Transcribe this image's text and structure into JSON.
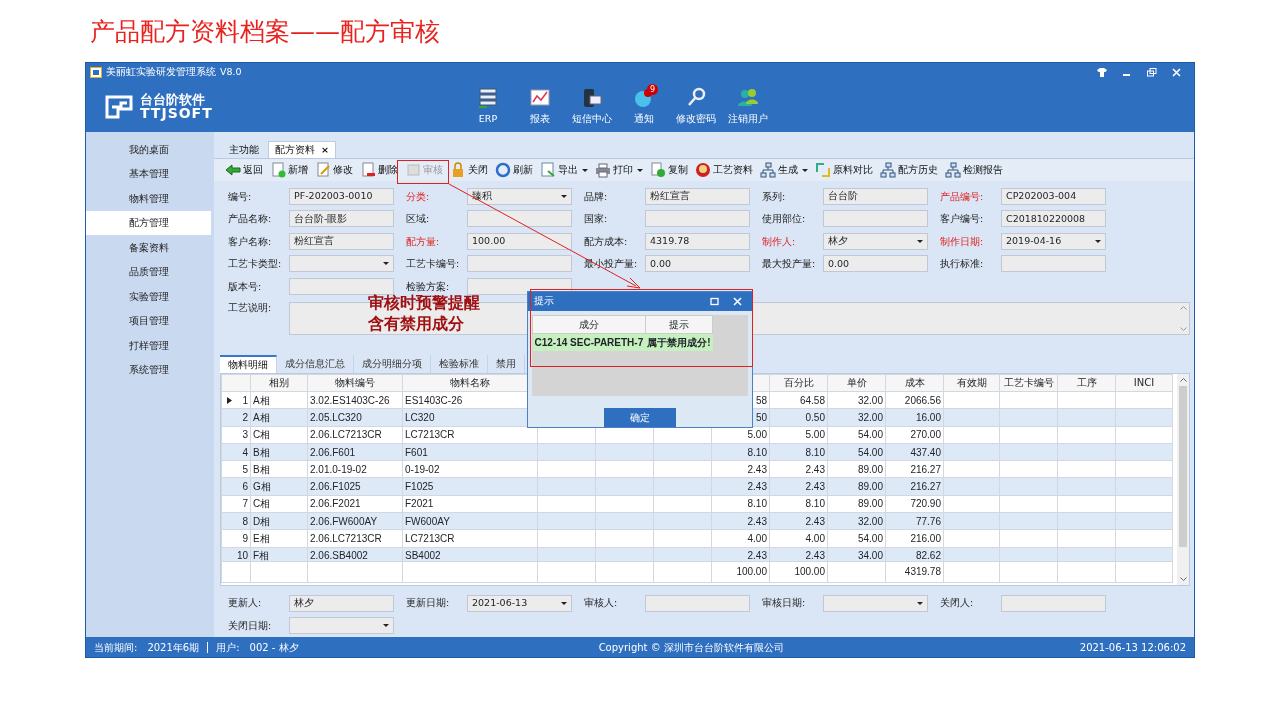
{
  "slide_title": "产品配方资料档案——配方审核",
  "window": {
    "title": "美丽虹实验研发管理系统",
    "version": "V8.0"
  },
  "logo": {
    "name": "台台阶软件",
    "latin": "TTJSOFT"
  },
  "header_buttons": [
    {
      "label": "ERP"
    },
    {
      "label": "报表"
    },
    {
      "label": "短信中心"
    },
    {
      "label": "通知",
      "badge": "9"
    },
    {
      "label": "修改密码"
    },
    {
      "label": "注销用户"
    }
  ],
  "sidebar": {
    "items": [
      {
        "label": "我的桌面",
        "selected": false
      },
      {
        "label": "基本管理",
        "selected": false
      },
      {
        "label": "物料管理",
        "selected": false
      },
      {
        "label": "配方管理",
        "selected": true
      },
      {
        "label": "备案资料",
        "selected": false
      },
      {
        "label": "品质管理",
        "selected": false
      },
      {
        "label": "实验管理",
        "selected": false
      },
      {
        "label": "项目管理",
        "selected": false
      },
      {
        "label": "打样管理",
        "selected": false
      },
      {
        "label": "系统管理",
        "selected": false
      }
    ]
  },
  "tabs": [
    {
      "label": "主功能",
      "selected": false
    },
    {
      "label": "配方资料",
      "selected": true,
      "close": "×"
    }
  ],
  "toolbar": [
    {
      "label": "返回",
      "disabled": false,
      "menu": false
    },
    {
      "label": "新增",
      "disabled": false,
      "menu": false
    },
    {
      "label": "修改",
      "disabled": false,
      "menu": false
    },
    {
      "label": "删除",
      "disabled": false,
      "menu": false
    },
    {
      "label": "审核",
      "disabled": true,
      "menu": false
    },
    {
      "label": "关闭",
      "disabled": false,
      "menu": false
    },
    {
      "label": "刷新",
      "disabled": false,
      "menu": false
    },
    {
      "label": "导出",
      "disabled": false,
      "menu": true
    },
    {
      "label": "打印",
      "disabled": false,
      "menu": true
    },
    {
      "label": "复制",
      "disabled": false,
      "menu": false
    },
    {
      "label": "工艺资料",
      "disabled": false,
      "menu": false
    },
    {
      "label": "生成",
      "disabled": false,
      "menu": true
    },
    {
      "label": "原料对比",
      "disabled": false,
      "menu": false
    },
    {
      "label": "配方历史",
      "disabled": false,
      "menu": false
    },
    {
      "label": "检测报告",
      "disabled": false,
      "menu": false
    }
  ],
  "form": {
    "rows": [
      [
        {
          "label": "编号:",
          "value": "PF-202003-0010",
          "required": false,
          "kind": "text"
        },
        {
          "label": "分类:",
          "value": "臻积",
          "required": true,
          "kind": "select"
        },
        {
          "label": "品牌:",
          "value": "粉红宣言",
          "required": false,
          "kind": "text"
        },
        {
          "label": "系列:",
          "value": "台台阶",
          "required": false,
          "kind": "text"
        },
        {
          "label": "产品编号:",
          "value": "CP202003-004",
          "required": true,
          "kind": "text"
        }
      ],
      [
        {
          "label": "产品名称:",
          "value": "台台阶-眼影",
          "required": false,
          "kind": "text"
        },
        {
          "label": "区域:",
          "required": false,
          "kind": "text"
        },
        {
          "label": "国家:",
          "required": false,
          "kind": "text"
        },
        {
          "label": "使用部位:",
          "required": false,
          "kind": "text"
        },
        {
          "label": "客户编号:",
          "value": "C201810220008",
          "required": false,
          "kind": "text"
        }
      ],
      [
        {
          "label": "客户名称:",
          "value": "粉红宣言",
          "required": false,
          "kind": "text"
        },
        {
          "label": "配方量:",
          "value": "100.00",
          "required": true,
          "kind": "text"
        },
        {
          "label": "配方成本:",
          "value": "4319.78",
          "required": false,
          "kind": "text"
        },
        {
          "label": "制作人:",
          "value": "林夕",
          "required": true,
          "kind": "select"
        },
        {
          "label": "制作日期:",
          "value": "2019-04-16",
          "required": true,
          "kind": "select"
        }
      ],
      [
        {
          "label": "工艺卡类型:",
          "required": false,
          "kind": "select"
        },
        {
          "label": "工艺卡编号:",
          "required": false,
          "kind": "text"
        },
        {
          "label": "最小投产量:",
          "value": "0.00",
          "required": false,
          "kind": "text"
        },
        {
          "label": "最大投产量:",
          "value": "0.00",
          "required": false,
          "kind": "text"
        },
        {
          "label": "执行标准:",
          "required": false,
          "kind": "text"
        }
      ],
      [
        {
          "label": "版本号:",
          "required": false,
          "kind": "text"
        },
        {
          "label": "检验方案:",
          "required": false,
          "kind": "text"
        }
      ]
    ],
    "notes": {
      "label": "工艺说明:"
    }
  },
  "grid_tabs": [
    {
      "label": "物料明细",
      "selected": true
    },
    {
      "label": "成分信息汇总",
      "selected": false
    },
    {
      "label": "成分明细分项",
      "selected": false
    },
    {
      "label": "检验标准",
      "selected": false
    },
    {
      "label": "禁用",
      "selected": false
    }
  ],
  "table": {
    "columns": [
      "相别",
      "物料编号",
      "物料名称",
      "百分比",
      "单价",
      "成本",
      "有效期",
      "工艺卡编号",
      "工序",
      "INCI"
    ],
    "rows": [
      {
        "selected": true,
        "no": "1",
        "group": "A相",
        "code": "3.02.ES1403C-26",
        "name": "ES1403C-26",
        "column_8": "58",
        "percent": "64.58",
        "price": "32.00",
        "cost": "2066.56"
      },
      {
        "selected": false,
        "no": "2",
        "group": "A相",
        "code": "2.05.LC320",
        "name": "LC320",
        "column_8": "50",
        "percent": "0.50",
        "price": "32.00",
        "cost": "16.00"
      },
      {
        "selected": false,
        "no": "3",
        "group": "C相",
        "code": "2.06.LC7213CR",
        "name": "LC7213CR",
        "column_8": "5.00",
        "percent": "5.00",
        "price": "54.00",
        "cost": "270.00"
      },
      {
        "selected": false,
        "no": "4",
        "group": "B相",
        "code": "2.06.F601",
        "name": "F601",
        "column_8": "8.10",
        "percent": "8.10",
        "price": "54.00",
        "cost": "437.40"
      },
      {
        "selected": false,
        "no": "5",
        "group": "B相",
        "code": "2.01.0-19-02",
        "name": "0-19-02",
        "column_8": "2.43",
        "percent": "2.43",
        "price": "89.00",
        "cost": "216.27"
      },
      {
        "selected": false,
        "no": "6",
        "group": "G相",
        "code": "2.06.F1025",
        "name": "F1025",
        "column_8": "2.43",
        "percent": "2.43",
        "price": "89.00",
        "cost": "216.27"
      },
      {
        "selected": false,
        "no": "7",
        "group": "C相",
        "code": "2.06.F2021",
        "name": "F2021",
        "column_8": "8.10",
        "percent": "8.10",
        "price": "89.00",
        "cost": "720.90"
      },
      {
        "selected": false,
        "no": "8",
        "group": "D相",
        "code": "2.06.FW600AY",
        "name": "FW600AY",
        "column_8": "2.43",
        "percent": "2.43",
        "price": "32.00",
        "cost": "77.76"
      },
      {
        "selected": false,
        "no": "9",
        "group": "E相",
        "code": "2.06.LC7213CR",
        "name": "LC7213CR",
        "column_8": "4.00",
        "percent": "4.00",
        "price": "54.00",
        "cost": "216.00"
      },
      {
        "selected": false,
        "no": "10",
        "group": "F相",
        "code": "2.06.SB4002",
        "name": "SB4002",
        "column_8": "2.43",
        "percent": "2.43",
        "price": "34.00",
        "cost": "82.62"
      }
    ],
    "totals": {
      "column_8": "100.00",
      "percent": "100.00",
      "cost": "4319.78"
    }
  },
  "footer_fields": [
    {
      "label": "更新人:",
      "value": "林夕",
      "kind": "text"
    },
    {
      "label": "更新日期:",
      "value": "2021-06-13",
      "kind": "select"
    },
    {
      "label": "审核人:",
      "kind": "text"
    },
    {
      "label": "审核日期:",
      "kind": "select"
    },
    {
      "label": "关闭人:",
      "kind": "text"
    },
    {
      "label": "关闭日期:",
      "kind": "select"
    }
  ],
  "status_bar": {
    "period_label": "当前期间:",
    "period": "2021年6期",
    "user_label": "用户:",
    "user": "002 - 林夕",
    "copyright": "Copyright © 深圳市台台阶软件有限公司",
    "datetime": "2021-06-13 12:06:02"
  },
  "dialog": {
    "title": "提示",
    "columns": [
      "成分",
      "提示"
    ],
    "rows": [
      [
        "C12-14 SEC-PARETH-7",
        "属于禁用成分!"
      ]
    ],
    "button": "确定"
  },
  "annotation": [
    "审核时预警提醒",
    "含有禁用成分"
  ]
}
